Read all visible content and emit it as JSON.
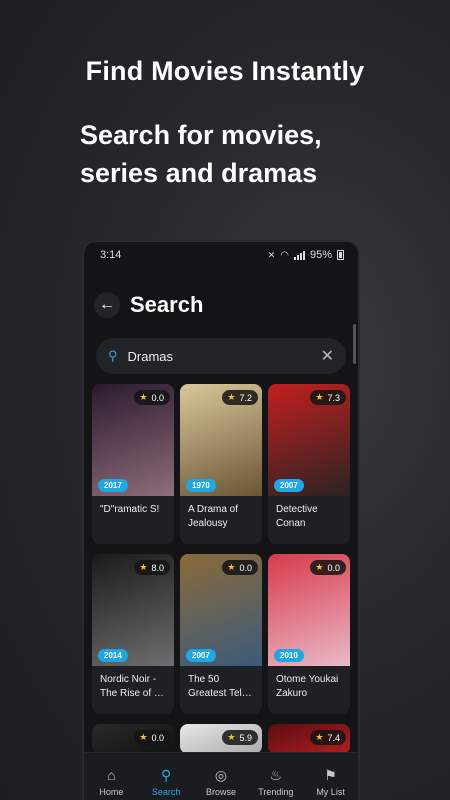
{
  "promo": {
    "title": "Find Movies Instantly",
    "subtitle": "Search for movies, series and dramas"
  },
  "status_bar": {
    "time": "3:14",
    "battery": "95%"
  },
  "header": {
    "title": "Search"
  },
  "search": {
    "value": "Dramas",
    "placeholder": ""
  },
  "results": [
    {
      "title": "\"D\"ramatic S!",
      "year": "2017",
      "rating": "0.0",
      "colors": [
        "#2a1a2e",
        "#8d6d7a"
      ]
    },
    {
      "title": "A Drama of Jealousy (an…",
      "year": "1970",
      "rating": "7.2",
      "colors": [
        "#d9c89b",
        "#6b5535"
      ]
    },
    {
      "title": "Detective Conan Dram…",
      "year": "2007",
      "rating": "7.3",
      "colors": [
        "#c22020",
        "#2a2222"
      ]
    },
    {
      "title": "Nordic Noir - The Rise of …",
      "year": "2014",
      "rating": "8.0",
      "colors": [
        "#1a1a1a",
        "#6e6e6e"
      ]
    },
    {
      "title": "The 50 Greatest Tel…",
      "year": "2007",
      "rating": "0.0",
      "colors": [
        "#8a6a3a",
        "#3c5a7a"
      ]
    },
    {
      "title": "Otome Youkai Zakuro Pictu…",
      "year": "2010",
      "rating": "0.0",
      "colors": [
        "#d83a4a",
        "#e9b9c8"
      ]
    }
  ],
  "partial_results": [
    {
      "rating": "0.0",
      "colors": [
        "#2a2a2a",
        "#111111"
      ]
    },
    {
      "rating": "5.9",
      "colors": [
        "#e8e8e8",
        "#aaaaaa"
      ]
    },
    {
      "rating": "7.4",
      "colors": [
        "#5a0d10",
        "#b21e22"
      ]
    }
  ],
  "nav": [
    {
      "label": "Home",
      "icon": "home-icon",
      "glyph": "⌂",
      "active": false
    },
    {
      "label": "Search",
      "icon": "search-icon",
      "glyph": "⚲",
      "active": true
    },
    {
      "label": "Browse",
      "icon": "compass-icon",
      "glyph": "◎",
      "active": false
    },
    {
      "label": "Trending",
      "icon": "flame-icon",
      "glyph": "♨",
      "active": false
    },
    {
      "label": "My List",
      "icon": "bookmark-icon",
      "glyph": "⚑",
      "active": false
    }
  ]
}
